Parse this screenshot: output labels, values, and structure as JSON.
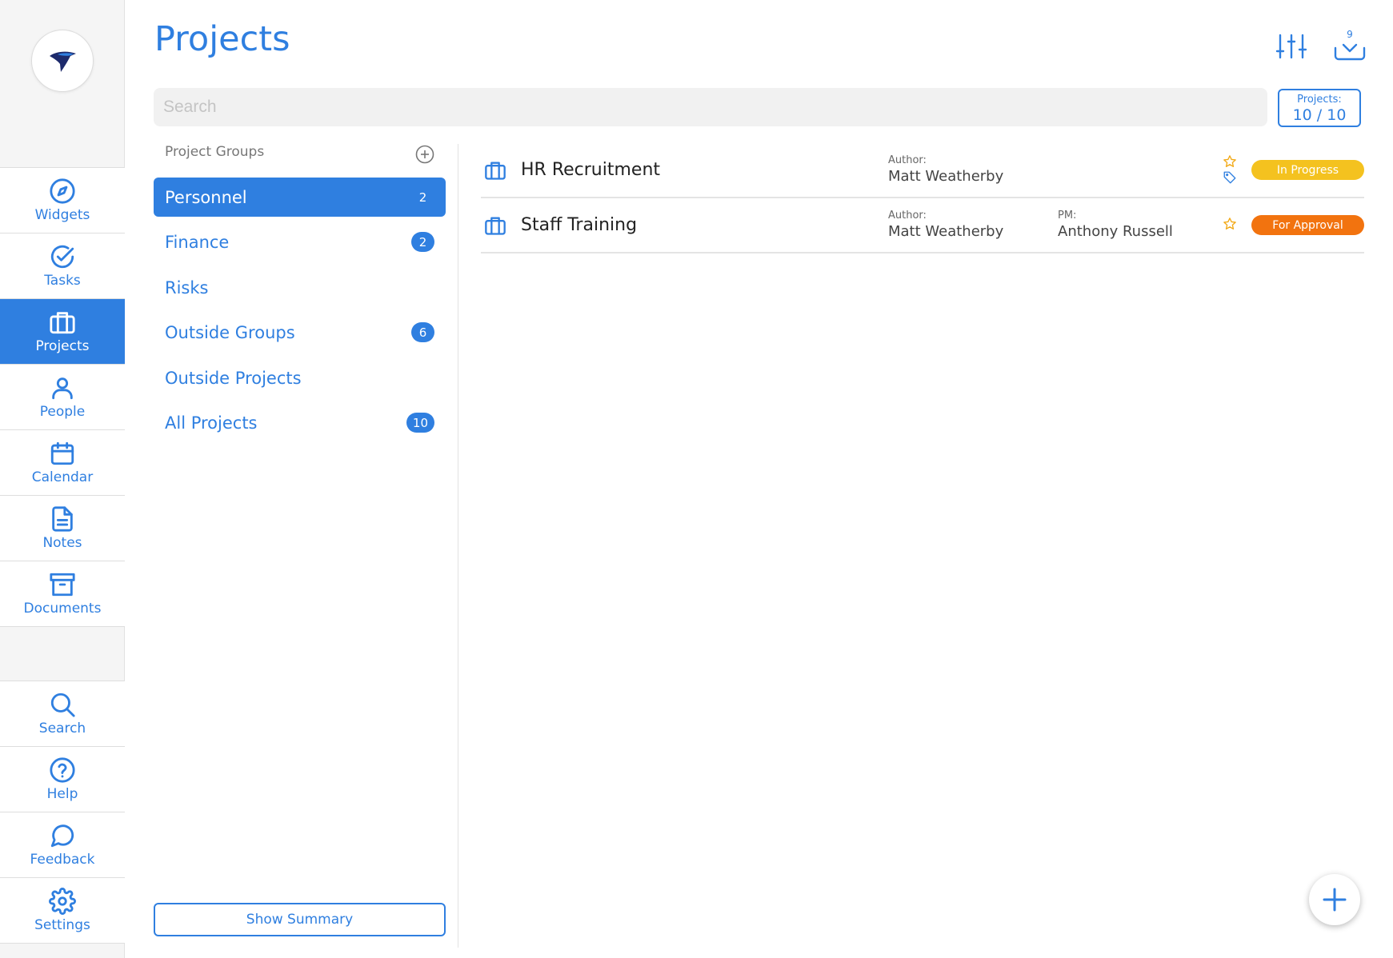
{
  "app": {
    "title": "Projects"
  },
  "colors": {
    "accent": "#2f7fe0",
    "in_progress": "#f4c21f",
    "for_approval": "#f2730f",
    "star": "#f2a917"
  },
  "nav": {
    "logo_icon": "bird-logo-icon",
    "items": [
      {
        "label": "Widgets",
        "icon": "compass-icon",
        "active": false
      },
      {
        "label": "Tasks",
        "icon": "check-circle-icon",
        "active": false
      },
      {
        "label": "Projects",
        "icon": "briefcase-icon",
        "active": true
      },
      {
        "label": "People",
        "icon": "person-icon",
        "active": false
      },
      {
        "label": "Calendar",
        "icon": "calendar-icon",
        "active": false
      },
      {
        "label": "Notes",
        "icon": "document-icon",
        "active": false
      },
      {
        "label": "Documents",
        "icon": "archive-box-icon",
        "active": false
      }
    ],
    "bottom_items": [
      {
        "label": "Search",
        "icon": "search-icon"
      },
      {
        "label": "Help",
        "icon": "help-icon"
      },
      {
        "label": "Feedback",
        "icon": "chat-bubble-icon"
      },
      {
        "label": "Settings",
        "icon": "gear-icon"
      }
    ]
  },
  "header": {
    "filter_icon": "sliders-icon",
    "inbox_icon": "inbox-download-icon",
    "inbox_count": "9"
  },
  "search": {
    "placeholder": "Search",
    "value": ""
  },
  "projects_count": {
    "label": "Projects:",
    "value": "10 / 10"
  },
  "groups": {
    "header": "Project Groups",
    "items": [
      {
        "name": "Personnel",
        "count": "2",
        "active": true
      },
      {
        "name": "Finance",
        "count": "2",
        "active": false
      },
      {
        "name": "Risks",
        "count": "",
        "active": false
      },
      {
        "name": "Outside Groups",
        "count": "6",
        "active": false
      },
      {
        "name": "Outside Projects",
        "count": "",
        "active": false
      },
      {
        "name": "All Projects",
        "count": "10",
        "active": false
      }
    ],
    "summary_button": "Show Summary"
  },
  "projects": [
    {
      "name": "HR Recruitment",
      "author_label": "Author:",
      "author": "Matt Weatherby",
      "pm_label": "",
      "pm": "",
      "starred": false,
      "tagged": true,
      "status": "In Progress",
      "status_color": "#f4c21f"
    },
    {
      "name": "Staff Training",
      "author_label": "Author:",
      "author": "Matt Weatherby",
      "pm_label": "PM:",
      "pm": "Anthony Russell",
      "starred": false,
      "tagged": false,
      "status": "For Approval",
      "status_color": "#f2730f"
    }
  ],
  "fab": {
    "icon": "plus-icon"
  }
}
